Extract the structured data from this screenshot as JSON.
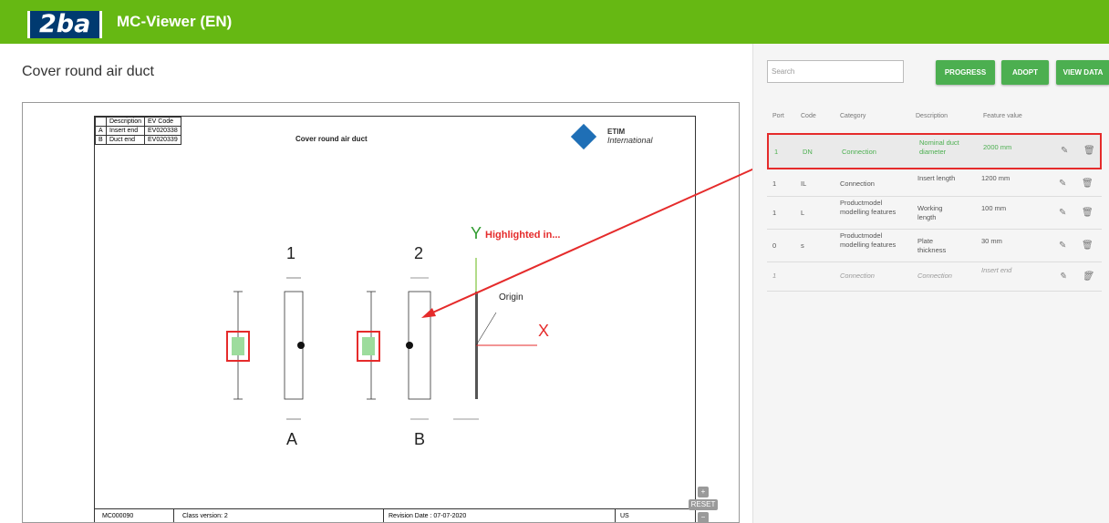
{
  "header": {
    "logo": "2ba",
    "title": "MC-Viewer (EN)"
  },
  "page_title": "Cover round air duct",
  "drawing": {
    "legend_headers": [
      "Description",
      "EV Code"
    ],
    "legend_rows": [
      {
        "key": "A",
        "desc": "Insert end",
        "code": "EV020338"
      },
      {
        "key": "B",
        "desc": "Duct end",
        "code": "EV020339"
      }
    ],
    "sheet_title": "Cover round air duct",
    "etim_top": "ETIM",
    "etim_bottom": "International",
    "label_1": "1",
    "label_2": "2",
    "label_a": "A",
    "label_b": "B",
    "axis_y": "Y",
    "axis_x": "X",
    "highlighted": "Highlighted in...",
    "origin": "Origin",
    "footer": {
      "code": "MC000090",
      "class_version": "Class version: 2",
      "revision": "Revision Date : 07-07-2020",
      "units": "US"
    }
  },
  "zoom": {
    "plus": "+",
    "reset": "RESET",
    "minus": "−"
  },
  "right": {
    "search_placeholder": "Search",
    "buttons": {
      "progress": "PROGRESS",
      "adopt": "ADOPT",
      "view_data": "VIEW DATA"
    },
    "columns": [
      "Port",
      "Code",
      "Category",
      "Description",
      "Feature value"
    ],
    "rows": [
      {
        "port": "1",
        "code": "DN",
        "category": "Connection",
        "description": "Nominal duct diameter",
        "value": "2000 mm"
      },
      {
        "port": "1",
        "code": "IL",
        "category": "Connection",
        "description": "Insert length",
        "value": "1200 mm"
      },
      {
        "port": "1",
        "code": "L",
        "category": "Productmodel modelling features",
        "description": "Working length",
        "value": "100 mm"
      },
      {
        "port": "0",
        "code": "s",
        "category": "Productmodel modelling features",
        "description": "Plate thickness",
        "value": "30 mm"
      },
      {
        "port": "1",
        "code": "",
        "category": "Connection",
        "description": "Connection",
        "value": "Insert end"
      }
    ]
  },
  "colors": {
    "brand_green": "#66b813",
    "button_green": "#4caf50",
    "highlight_red": "#e52b2b",
    "logo_blue": "#003a70"
  }
}
